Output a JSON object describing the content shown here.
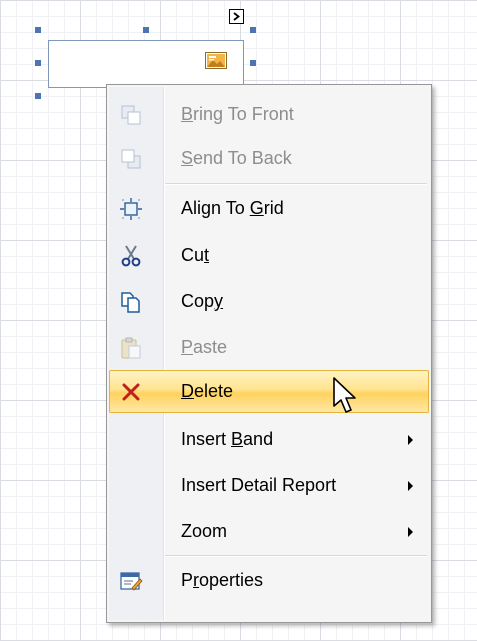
{
  "design_surface": {
    "selected_control": {
      "icon": "picture-icon"
    },
    "smart_tag": {
      "icon": "chevron-right-icon"
    }
  },
  "context_menu": {
    "items": [
      {
        "label_pre": "",
        "label_key": "B",
        "label_post": "ring To Front",
        "icon": "bring-to-front-icon",
        "enabled": false,
        "submenu": false
      },
      {
        "label_pre": "",
        "label_key": "S",
        "label_post": "end To Back",
        "icon": "send-to-back-icon",
        "enabled": false,
        "submenu": false
      },
      {
        "label_pre": "Align To ",
        "label_key": "G",
        "label_post": "rid",
        "icon": "align-to-grid-icon",
        "enabled": true,
        "submenu": false
      },
      {
        "label_pre": "Cu",
        "label_key": "t",
        "label_post": "",
        "icon": "scissors-icon",
        "enabled": true,
        "submenu": false
      },
      {
        "label_pre": "Cop",
        "label_key": "y",
        "label_post": "",
        "icon": "copy-icon",
        "enabled": true,
        "submenu": false
      },
      {
        "label_pre": "",
        "label_key": "P",
        "label_post": "aste",
        "icon": "paste-icon",
        "enabled": false,
        "submenu": false
      },
      {
        "label_pre": "",
        "label_key": "D",
        "label_post": "elete",
        "icon": "delete-x-icon",
        "enabled": true,
        "submenu": false,
        "highlighted": true
      },
      {
        "label_pre": "Insert ",
        "label_key": "B",
        "label_post": "and",
        "icon": "",
        "enabled": true,
        "submenu": true
      },
      {
        "label_pre": "Insert Detail Report",
        "label_key": "",
        "label_post": "",
        "icon": "",
        "enabled": true,
        "submenu": true
      },
      {
        "label_pre": "Zoom",
        "label_key": "",
        "label_post": "",
        "icon": "",
        "enabled": true,
        "submenu": true
      },
      {
        "label_pre": "P",
        "label_key": "r",
        "label_post": "operties",
        "icon": "properties-icon",
        "enabled": true,
        "submenu": false
      }
    ]
  },
  "colors": {
    "highlight_border": "#e5b43c",
    "highlight_fill": "#ffd260",
    "delete_icon": "#c0201b",
    "handle": "#4f72b3"
  }
}
